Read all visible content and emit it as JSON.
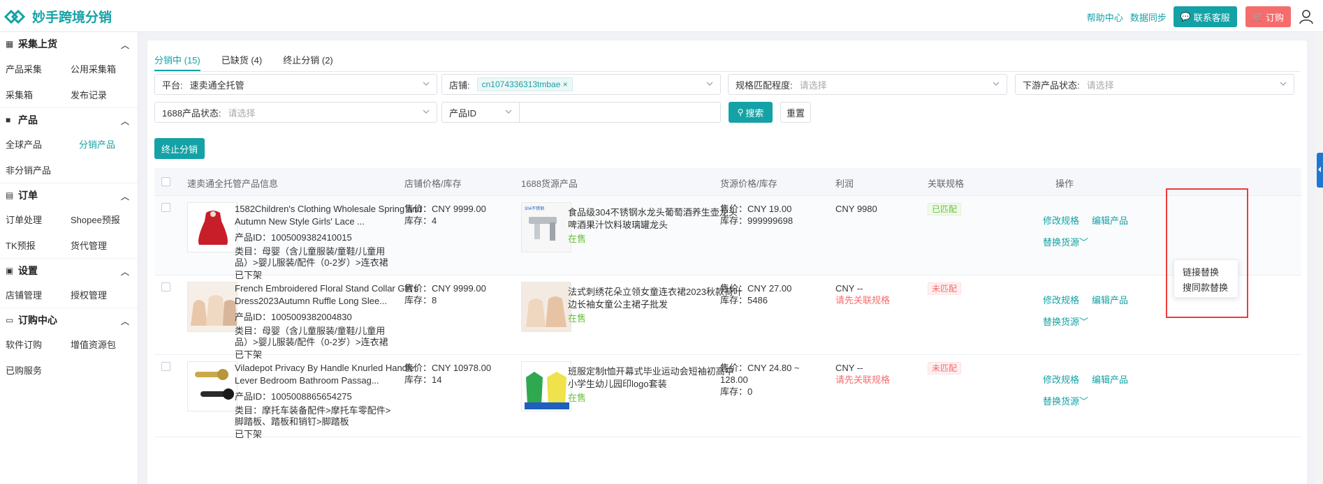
{
  "app": {
    "name": "妙手跨境分销"
  },
  "topbar": {
    "help": "帮助中心",
    "sync": "数据同步",
    "contact": "联系客服",
    "order": "订购"
  },
  "sidebar": {
    "sections": [
      {
        "title": "采集上货",
        "items": [
          "产品采集",
          "公用采集箱",
          "采集箱",
          "发布记录"
        ]
      },
      {
        "title": "产品",
        "items": [
          "全球产品",
          "分销产品",
          "非分销产品"
        ]
      },
      {
        "title": "订单",
        "items": [
          "订单处理",
          "Shopee预报",
          "TK预报",
          "货代管理"
        ]
      },
      {
        "title": "设置",
        "items": [
          "店铺管理",
          "授权管理"
        ]
      },
      {
        "title": "订购中心",
        "items": [
          "软件订购",
          "增值资源包",
          "已购服务"
        ]
      }
    ]
  },
  "tabs": [
    "分销中 (15)",
    "已缺货 (4)",
    "终止分销 (2)"
  ],
  "filters": {
    "platform_label": "平台:",
    "platform_value": "速卖通全托管",
    "shop_label": "店铺:",
    "shop_tag": "cn1074336313tmbae",
    "spec_label": "规格匹配程度:",
    "spec_ph": "请选择",
    "down_label": "下游产品状态:",
    "down_ph": "请选择",
    "src_label": "1688产品状态:",
    "src_ph": "请选择",
    "id_select": "产品ID",
    "search": "搜索",
    "reset": "重置"
  },
  "stop_button": "终止分销",
  "table": {
    "headers": [
      "速卖通全托管产品信息",
      "店铺价格/库存",
      "1688货源产品",
      "货源价格/库存",
      "利润",
      "关联规格",
      "操作"
    ],
    "rows": [
      {
        "title": "1582Children's Clothing Wholesale Spring and Autumn New Style Girls' Lace ...",
        "pid": "产品ID：1005009382410015",
        "cat": "类目：母婴（含儿童服装/童鞋/儿童用品）>婴儿服装/配件（0-2岁）>连衣裙",
        "status": "已下架",
        "price": "售价：CNY 9999.00",
        "stock": "库存：4",
        "src_title": "食品级304不锈钢水龙头葡萄酒养生壶龙头啤酒果汁饮料玻璃罐龙头",
        "src_status": "在售",
        "src_price": "售价：CNY 19.00",
        "src_stock": "库存：999999698",
        "profit": "CNY 9980",
        "profit_note": "",
        "match": "已匹配",
        "op_edit_spec": "修改规格",
        "op_edit_prod": "编辑产品",
        "op_replace": "替换货源"
      },
      {
        "title": "French Embroidered Floral Stand Collar Girl's Dress2023Autumn Ruffle Long Slee...",
        "pid": "产品ID：1005009382004830",
        "cat": "类目：母婴（含儿童服装/童鞋/儿童用品）>婴儿服装/配件（0-2岁）>连衣裙",
        "status": "已下架",
        "price": "售价：CNY 9999.00",
        "stock": "库存：8",
        "src_title": "法式刺绣花朵立领女童连衣裙2023秋款荷叶边长袖女童公主裙子批发",
        "src_status": "在售",
        "src_price": "售价：CNY 27.00",
        "src_stock": "库存：5486",
        "profit": "CNY --",
        "profit_note": "请先关联规格",
        "match": "未匹配",
        "op_edit_spec": "修改规格",
        "op_edit_prod": "编辑产品",
        "op_replace": "替换货源"
      },
      {
        "title": "Viladepot Privacy By Handle Knurled Handle Lever Bedroom Bathroom Passag...",
        "pid": "产品ID：1005008865654275",
        "cat": "类目：摩托车装备配件>摩托车零配件>脚踏板、踏板和销钉>脚踏板",
        "status": "已下架",
        "price": "售价：CNY 10978.00",
        "stock": "库存：14",
        "src_title": "班服定制t恤开幕式毕业运动会短袖初高中小学生幼儿园印logo套装",
        "src_status": "在售",
        "src_price": "售价：CNY 24.80 ~ 128.00",
        "src_stock": "库存：0",
        "profit": "CNY --",
        "profit_note": "请先关联规格",
        "match": "未匹配",
        "op_edit_spec": "修改规格",
        "op_edit_prod": "编辑产品",
        "op_replace": "替换货源"
      }
    ]
  },
  "dropdown": {
    "items": [
      "链接替换",
      "搜同款替换"
    ]
  },
  "colors": {
    "accent": "#14a2a6",
    "danger": "#f56c6c",
    "success": "#67c23a",
    "highlight_box": "#f03a3a"
  }
}
